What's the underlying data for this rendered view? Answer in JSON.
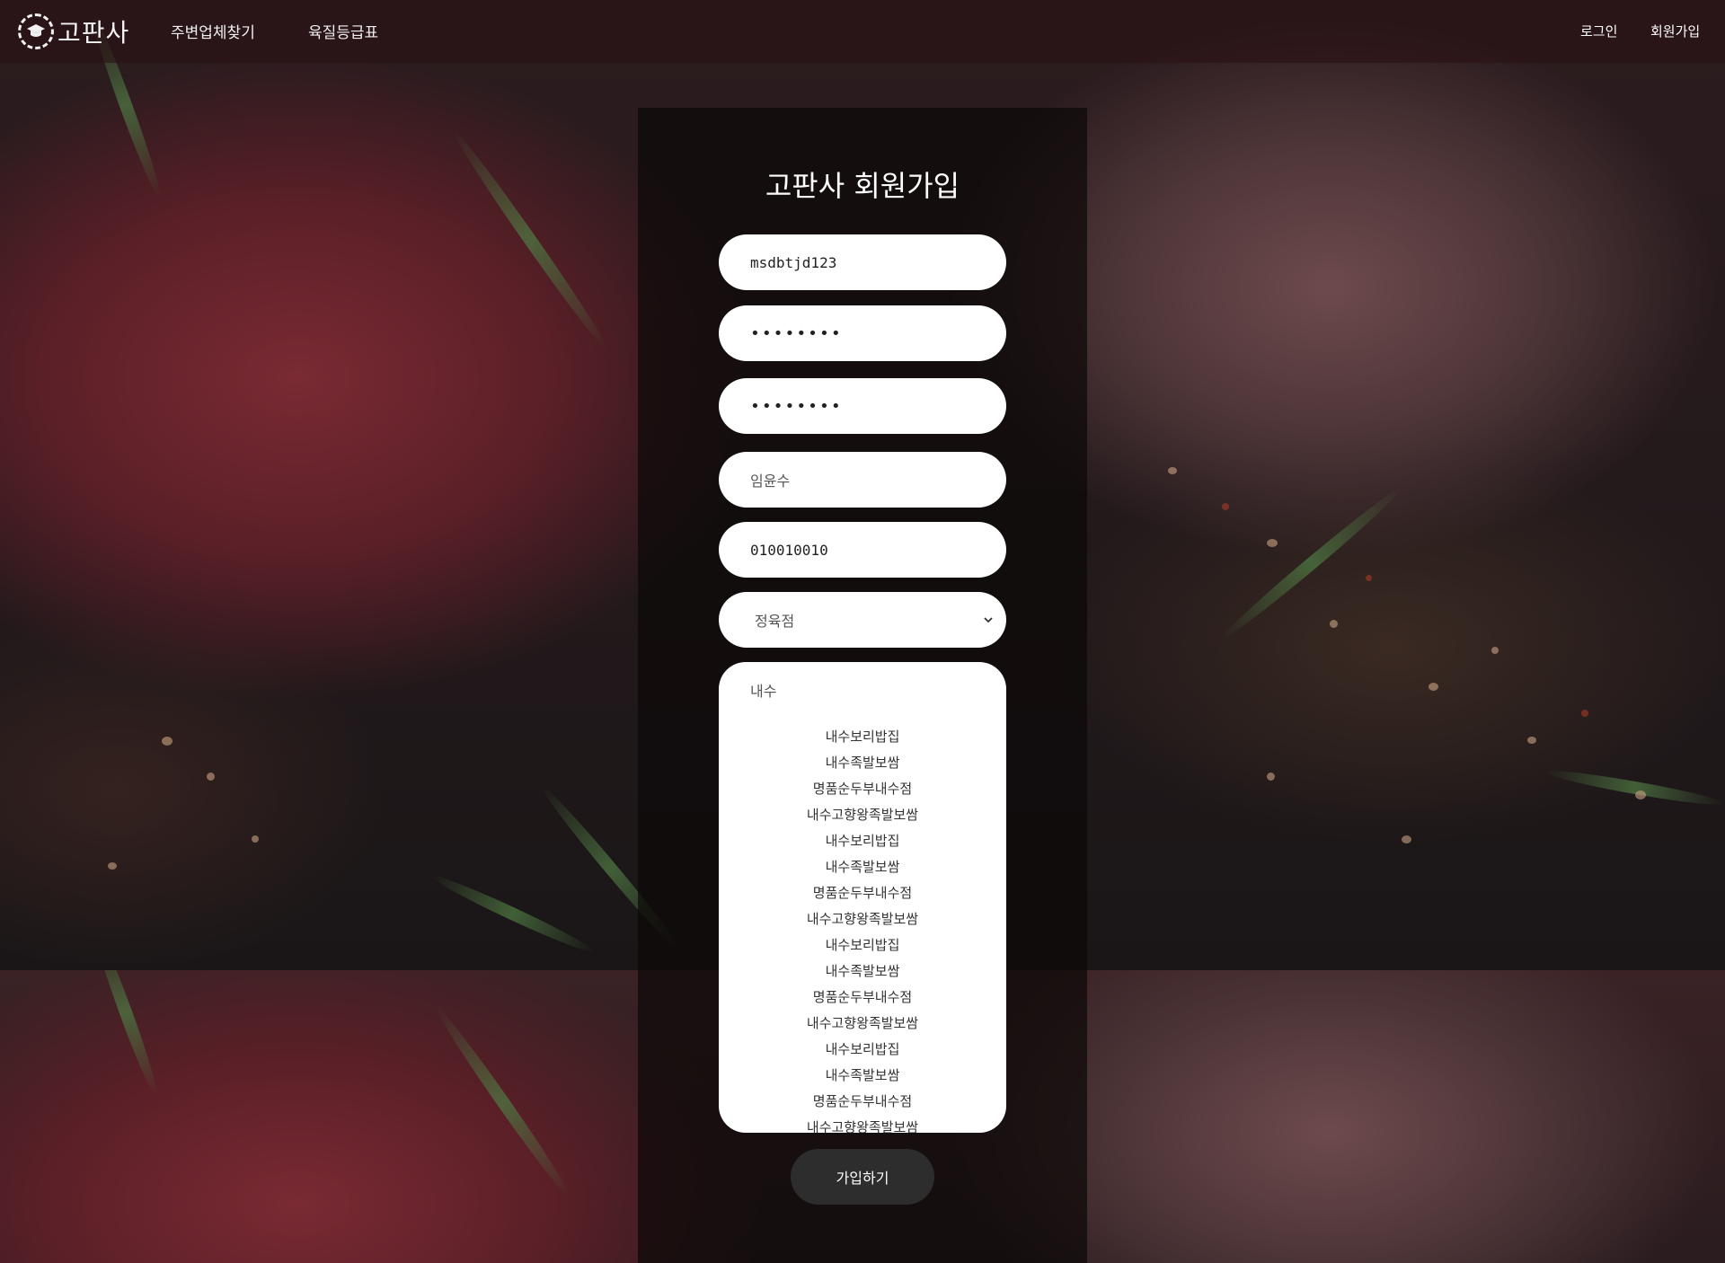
{
  "header": {
    "logo_text": "고판사",
    "nav": [
      {
        "label": "주변업체찾기"
      },
      {
        "label": "육질등급표"
      }
    ],
    "auth": {
      "login_label": "로그인",
      "signup_label": "회원가입"
    }
  },
  "form": {
    "title": "고판사 회원가입",
    "user_id": "msdbtjd123",
    "password": "••••••••",
    "password_confirm": "••••••••",
    "name": "임윤수",
    "phone": "010010010",
    "store_type": "정육점",
    "store_search": "내수",
    "store_results": [
      "내수보리밥집",
      "내수족발보쌈",
      "명품순두부내수점",
      "내수고향왕족발보쌈",
      "내수보리밥집",
      "내수족발보쌈",
      "명품순두부내수점",
      "내수고향왕족발보쌈",
      "내수보리밥집",
      "내수족발보쌈",
      "명품순두부내수점",
      "내수고향왕족발보쌈",
      "내수보리밥집",
      "내수족발보쌈",
      "명품순두부내수점",
      "내수고향왕족발보쌈"
    ],
    "submit_label": "가입하기"
  },
  "icons": {
    "logo": "graduation-cap-icon",
    "select": "chevron-down-icon"
  },
  "colors": {
    "header_bg": "#3a1217",
    "panel_bg": "#0c0809",
    "submit_bg": "#2d2d2d",
    "field_bg": "#ffffff"
  }
}
